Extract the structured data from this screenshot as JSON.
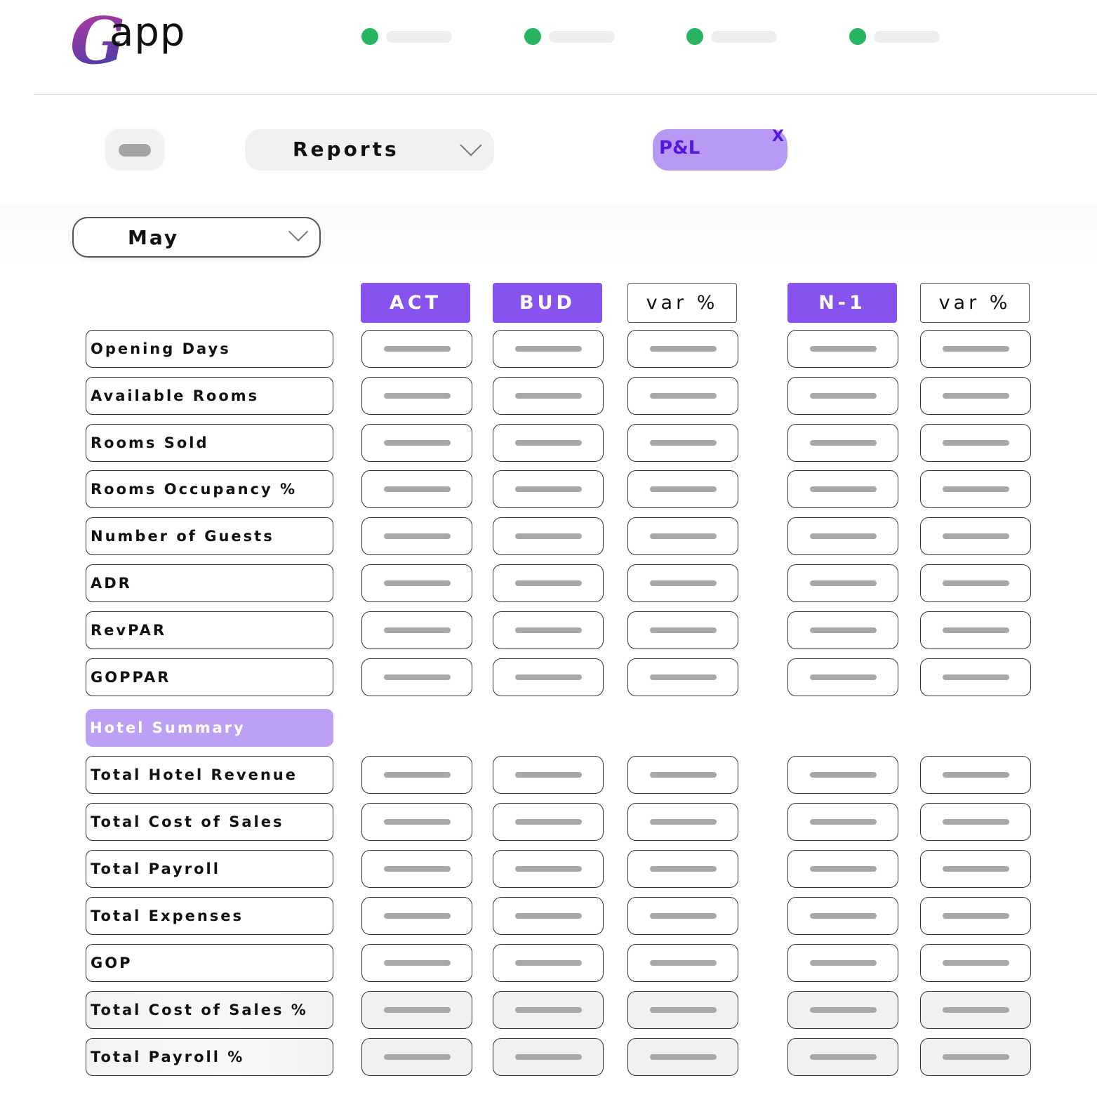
{
  "header": {
    "logo": {
      "initial": "G",
      "rest": "app"
    },
    "steps": [
      {
        "status": "complete",
        "color": "#27b561"
      },
      {
        "status": "complete",
        "color": "#27b561"
      },
      {
        "status": "complete",
        "color": "#27b561"
      },
      {
        "status": "complete",
        "color": "#27b561"
      }
    ]
  },
  "toolbar": {
    "reports_select": {
      "value": "Reports"
    },
    "active_filter": {
      "label": "P&L",
      "close": "X"
    }
  },
  "period": {
    "month": "May"
  },
  "columns": [
    {
      "label": "ACT",
      "style": "filled"
    },
    {
      "label": "BUD",
      "style": "filled"
    },
    {
      "label": "var %",
      "style": "outline"
    },
    {
      "label": "N-1",
      "style": "filled"
    },
    {
      "label": "var %",
      "style": "outline"
    }
  ],
  "kpi_rows": [
    {
      "label": "Opening Days"
    },
    {
      "label": "Available Rooms"
    },
    {
      "label": "Rooms Sold"
    },
    {
      "label": "Rooms Occupancy %"
    },
    {
      "label": "Number of Guests"
    },
    {
      "label": "ADR"
    },
    {
      "label": "RevPAR"
    },
    {
      "label": "GOPPAR"
    }
  ],
  "section": {
    "label": "Hotel Summary"
  },
  "summary_rows": [
    {
      "label": "Total Hotel Revenue"
    },
    {
      "label": "Total Cost of Sales"
    },
    {
      "label": "Total Payroll"
    },
    {
      "label": "Total Expenses"
    },
    {
      "label": "GOP"
    },
    {
      "label": "Total Cost of Sales %"
    },
    {
      "label": "Total Payroll %"
    }
  ],
  "colors": {
    "accent": "#8653ef",
    "chip": "#b89af6",
    "chip_text": "#5516de",
    "section": "#bda0f4",
    "status_green": "#27b561"
  }
}
